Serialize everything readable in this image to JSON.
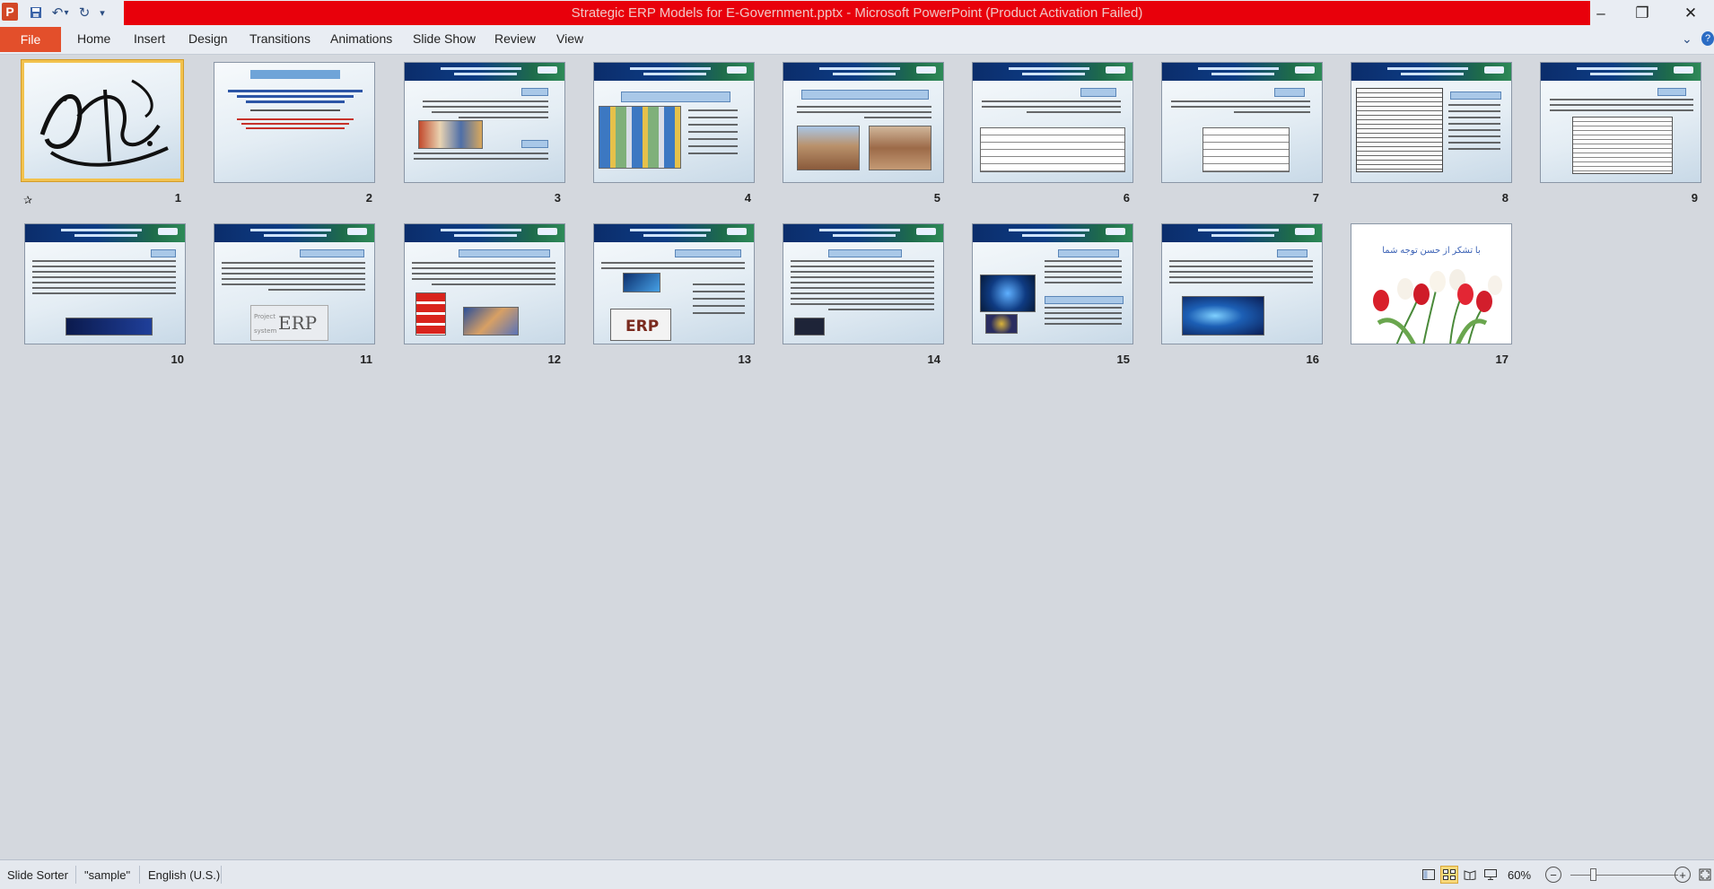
{
  "window": {
    "title": "Strategic ERP Models for E-Government.pptx  -  Microsoft PowerPoint (Product Activation Failed)"
  },
  "quick_access": {
    "app_icon": "P",
    "save_icon": "save-icon",
    "undo_icon": "undo-icon",
    "redo_icon": "redo-icon",
    "customize_icon": "customize-qat-icon"
  },
  "window_controls": {
    "minimize": "–",
    "restore": "❐",
    "close": "✕"
  },
  "ribbon": {
    "file_label": "File",
    "tabs": [
      "Home",
      "Insert",
      "Design",
      "Transitions",
      "Animations",
      "Slide Show",
      "Review",
      "View"
    ]
  },
  "slides": [
    {
      "number": "1",
      "kind": "calligraphy",
      "selected": true
    },
    {
      "number": "2",
      "kind": "title"
    },
    {
      "number": "3",
      "kind": "text-image"
    },
    {
      "number": "4",
      "kind": "list-image"
    },
    {
      "number": "5",
      "kind": "photos"
    },
    {
      "number": "6",
      "kind": "table"
    },
    {
      "number": "7",
      "kind": "small-table"
    },
    {
      "number": "8",
      "kind": "big-table"
    },
    {
      "number": "9",
      "kind": "table-right"
    },
    {
      "number": "10",
      "kind": "text-banner"
    },
    {
      "number": "11",
      "kind": "text-erp"
    },
    {
      "number": "12",
      "kind": "erp-images"
    },
    {
      "number": "13",
      "kind": "erp-cloud"
    },
    {
      "number": "14",
      "kind": "text-dense"
    },
    {
      "number": "15",
      "kind": "security"
    },
    {
      "number": "16",
      "kind": "network"
    },
    {
      "number": "17",
      "kind": "thanks",
      "text": "با تشکر از حسن توجه شما"
    }
  ],
  "status": {
    "view": "Slide Sorter",
    "theme": "\"sample\"",
    "language": "English (U.S.)",
    "zoom": "60%",
    "zoom_fraction": 0.2
  },
  "colors": {
    "title_bar": "#e8000b",
    "file_tab": "#e34f2b",
    "selection": "#f2c24e"
  }
}
